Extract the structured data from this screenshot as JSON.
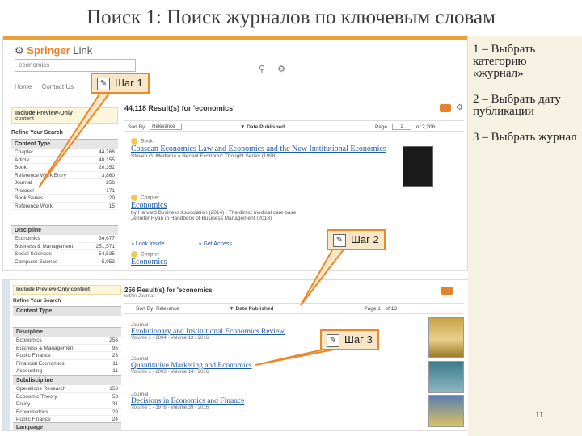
{
  "slide": {
    "title": "Поиск 1: Поиск журналов по ключевым словам",
    "page_number": "11"
  },
  "notes": [
    "1 – Выбрать категорию «журнал»",
    "2 – Выбрать дату публикации",
    "3 – Выбрать журнал"
  ],
  "callouts": {
    "step1": "Шаг 1",
    "step2": "Шаг 2",
    "step3": "Шаг 3"
  },
  "shot1": {
    "logo_prefix": "Springer",
    "logo_suffix": "Link",
    "search_value": "economics",
    "nav": [
      "Home",
      "Contact Us"
    ],
    "preview_label": "Include Preview-Only",
    "preview_sub": "content",
    "refine_label": "Refine Your Search",
    "content_type_head": "Content Type",
    "content_types": [
      {
        "label": "Chapter",
        "count": "44,766"
      },
      {
        "label": "Article",
        "count": "40,155"
      },
      {
        "label": "Book",
        "count": "20,352"
      },
      {
        "label": "Reference Work Entry",
        "count": "3,860"
      },
      {
        "label": "Journal",
        "count": "256"
      },
      {
        "label": "Protocol",
        "count": "171"
      },
      {
        "label": "Book Series",
        "count": "29"
      },
      {
        "label": "Reference Work",
        "count": "15"
      }
    ],
    "discipline_head": "Discipline",
    "disciplines": [
      {
        "label": "Economics",
        "count": "34,677"
      },
      {
        "label": "Business & Management",
        "count": "251,571"
      },
      {
        "label": "Social Sciences",
        "count": "54,535"
      },
      {
        "label": "Computer Science",
        "count": "5,953"
      }
    ],
    "results_heading": "44,118 Result(s) for 'economics'",
    "sort_label": "Sort By",
    "sort_value": "Relevance",
    "date_label": "Date Published",
    "page_label": "Page",
    "page_value": "1",
    "page_of": "of 2,206",
    "results": [
      {
        "type": "Book",
        "title": "Coasean Economics Law and Economics and the New Institutional Economics",
        "meta": "Steven G. Medema » Recent Economic Thought Series (1998)"
      },
      {
        "type": "Chapter",
        "title": "Economics",
        "meta": "by Harvard Business Association (2014) · The direct medical care base",
        "meta2": "Jennifer Ryan in Handbook of Business Management (2013)"
      }
    ],
    "look_inside": "» Look Inside",
    "get_access": "» Get Access",
    "third_type": "Chapter",
    "third_title": "Economics"
  },
  "shot2": {
    "preview_label": "Include Preview-Only content",
    "refine_label": "Refine Your Search",
    "content_type_head": "Content Type",
    "discipline_head": "Discipline",
    "disciplines": [
      {
        "label": "Economics",
        "count": "256"
      },
      {
        "label": "Business & Management",
        "count": "96"
      },
      {
        "label": "Public Finance",
        "count": "23"
      },
      {
        "label": "Financial Economics",
        "count": "11"
      },
      {
        "label": "Accounting",
        "count": "11"
      }
    ],
    "subdiscipline_head": "Subdiscipline",
    "subdisciplines": [
      {
        "label": "Operations Research",
        "count": "158"
      },
      {
        "label": "Economic Theory",
        "count": "53"
      },
      {
        "label": "Policy",
        "count": "31"
      },
      {
        "label": "Econometrics",
        "count": "29"
      },
      {
        "label": "Public Finance",
        "count": "24"
      }
    ],
    "language_head": "Language",
    "results_heading": "256 Result(s) for 'economics'",
    "results_sub": "within Journal",
    "sort_label": "Sort By",
    "sort_value": "Relevance",
    "date_label": "Date Published",
    "page_label": "Page",
    "page_value": "1",
    "page_of": "of 13",
    "results": [
      {
        "type": "Journal",
        "title": "Evolutionary and Institutional Economics Review",
        "meta": "Volume 1 - 2004 · Volume 13 - 2016"
      },
      {
        "type": "Journal",
        "title": "Quantitative Marketing and Economics",
        "meta": "Volume 1 - 2003 · Volume 14 - 2016"
      },
      {
        "type": "Journal",
        "title": "Decisions in Economics and Finance",
        "meta": "Volume 1 - 1978 · Volume 39 - 2016"
      }
    ]
  },
  "colors": {
    "accent": "#e8892b",
    "callout_fill": "#f7e6c8",
    "link": "#1e5aa8",
    "notes_bg": "#f7f1e4"
  }
}
